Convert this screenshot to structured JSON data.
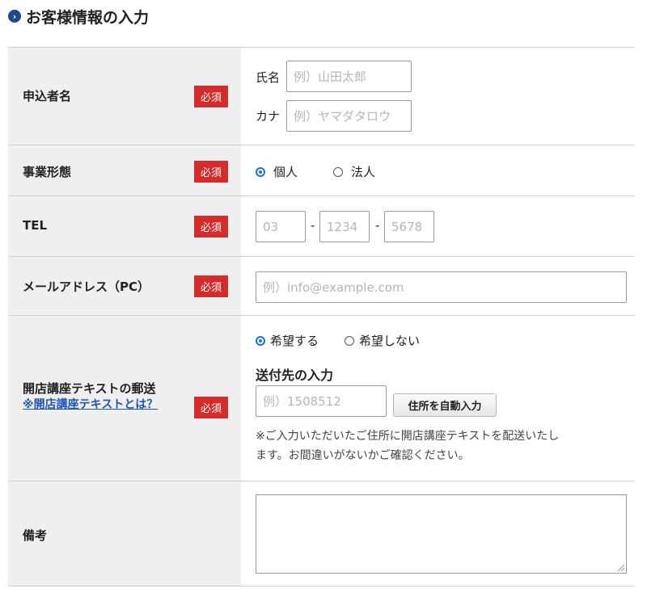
{
  "section": {
    "title": "お客様情報の入力"
  },
  "required_label": "必須",
  "applicant": {
    "label": "申込者名",
    "name_label": "氏名",
    "name_placeholder": "例）山田太郎",
    "kana_label": "カナ",
    "kana_placeholder": "例）ヤマダタロウ"
  },
  "business": {
    "label": "事業形態",
    "options": [
      {
        "label": "個人",
        "selected": true
      },
      {
        "label": "法人",
        "selected": false
      }
    ]
  },
  "tel": {
    "label": "TEL",
    "placeholders": [
      "03",
      "1234",
      "5678"
    ],
    "separator": "-"
  },
  "email": {
    "label": "メールアドレス（PC）",
    "placeholder": "例）info@example.com"
  },
  "textbook": {
    "label": "開店講座テキストの郵送",
    "link": "※開店講座テキストとは？",
    "options": [
      {
        "label": "希望する",
        "selected": true
      },
      {
        "label": "希望しない",
        "selected": false
      }
    ],
    "subheading": "送付先の入力",
    "zip_placeholder": "例）1508512",
    "autofill_button": "住所を自動入力",
    "note_line1": "※ご入力いただいたご住所に開店講座テキストを配送いたし",
    "note_line2": "ます。お間違いがないかご確認ください。"
  },
  "remarks": {
    "label": "備考",
    "value": ""
  },
  "colors": {
    "accent": "#1d4a8c",
    "required": "#d42b2b",
    "header_bg": "#efefef",
    "link": "#1d55b5"
  }
}
